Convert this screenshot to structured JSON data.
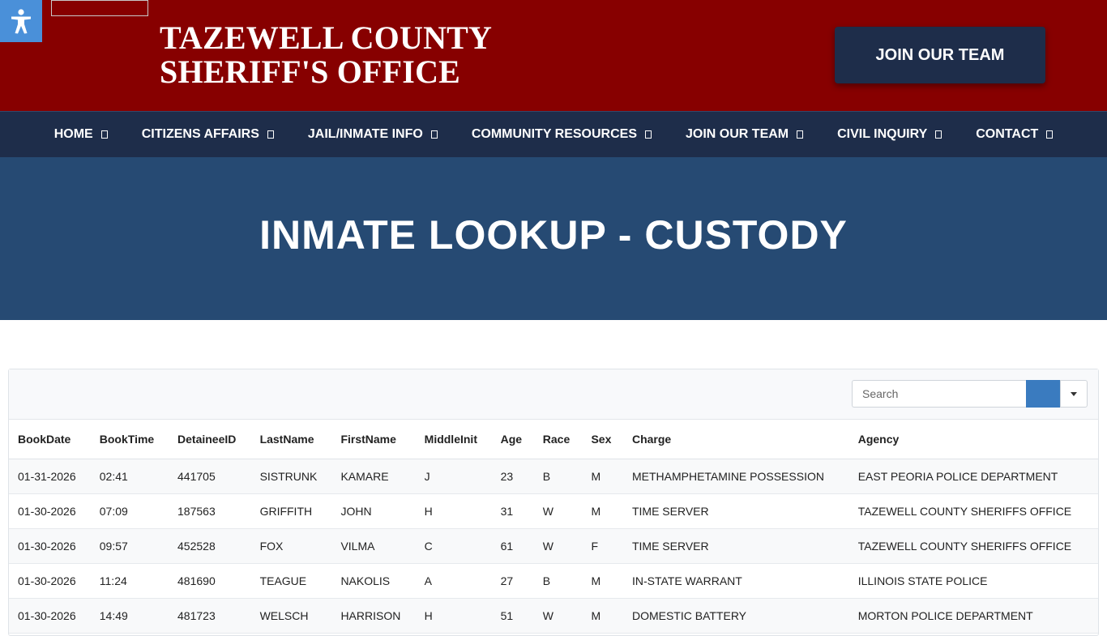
{
  "header": {
    "title_line1": "TAZEWELL COUNTY",
    "title_line2": "SHERIFF'S OFFICE",
    "join_button": "JOIN OUR TEAM",
    "accessibility_icon": "accessibility-person-icon",
    "brand_color": "#870000"
  },
  "nav": {
    "items": [
      {
        "label": "HOME"
      },
      {
        "label": "CITIZENS AFFAIRS"
      },
      {
        "label": "JAIL/INMATE INFO"
      },
      {
        "label": "COMMUNITY RESOURCES"
      },
      {
        "label": "JOIN OUR TEAM"
      },
      {
        "label": "CIVIL INQUIRY"
      },
      {
        "label": "CONTACT"
      }
    ]
  },
  "hero": {
    "title": "INMATE LOOKUP - CUSTODY"
  },
  "search": {
    "placeholder": "Search"
  },
  "table": {
    "columns": [
      "BookDate",
      "BookTime",
      "DetaineeID",
      "LastName",
      "FirstName",
      "MiddleInit",
      "Age",
      "Race",
      "Sex",
      "Charge",
      "Agency"
    ],
    "rows": [
      [
        "01-31-2026",
        "02:41",
        "441705",
        "SISTRUNK",
        "KAMARE",
        "J",
        "23",
        "B",
        "M",
        "METHAMPHETAMINE POSSESSION",
        "EAST PEORIA POLICE DEPARTMENT"
      ],
      [
        "01-30-2026",
        "07:09",
        "187563",
        "GRIFFITH",
        "JOHN",
        "H",
        "31",
        "W",
        "M",
        "TIME SERVER",
        "TAZEWELL COUNTY SHERIFFS OFFICE"
      ],
      [
        "01-30-2026",
        "09:57",
        "452528",
        "FOX",
        "VILMA",
        "C",
        "61",
        "W",
        "F",
        "TIME SERVER",
        "TAZEWELL COUNTY SHERIFFS OFFICE"
      ],
      [
        "01-30-2026",
        "11:24",
        "481690",
        "TEAGUE",
        "NAKOLIS",
        "A",
        "27",
        "B",
        "M",
        "IN-STATE WARRANT",
        "ILLINOIS STATE POLICE"
      ],
      [
        "01-30-2026",
        "14:49",
        "481723",
        "WELSCH",
        "HARRISON",
        "H",
        "51",
        "W",
        "M",
        "DOMESTIC BATTERY",
        "MORTON POLICE DEPARTMENT"
      ]
    ]
  }
}
